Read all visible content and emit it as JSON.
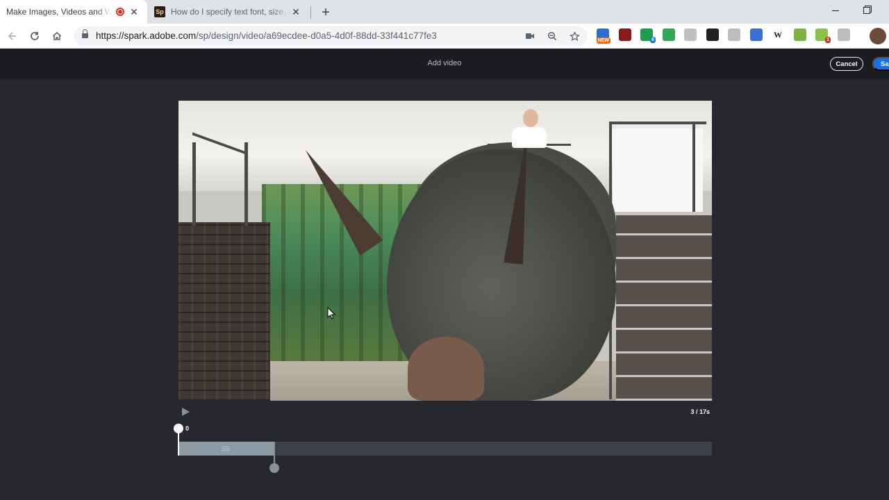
{
  "browser": {
    "tabs": [
      {
        "title": "Make Images, Videos and Web Stories",
        "active": true,
        "recording": true
      },
      {
        "title": "How do I specify text font, size, and",
        "active": false,
        "favicon": "Sp"
      }
    ],
    "new_tab_icon": "plus-icon",
    "address": {
      "host": "https://spark.adobe.com",
      "path": "/sp/design/video/a69ecdee-d0a5-4d0f-88dd-33f441c77fe3"
    },
    "extensions": [
      {
        "name": "new-badge-extension-icon",
        "badge": "NEW",
        "color": "#2a6fd6"
      },
      {
        "name": "speaker-extension-icon",
        "badge": "",
        "color": "#8b1a1a"
      },
      {
        "name": "green-chat-extension-icon",
        "badge": "6",
        "color": "#1e9e4a"
      },
      {
        "name": "green-doc-extension-icon",
        "badge": "",
        "color": "#34a853"
      },
      {
        "name": "help-circle-extension-icon",
        "badge": "",
        "color": "#c0c0c0"
      },
      {
        "name": "microphone-extension-icon",
        "badge": "",
        "color": "#202124"
      },
      {
        "name": "save-extension-icon",
        "badge": "",
        "color": "#bdbdbd"
      },
      {
        "name": "calendar-extension-icon",
        "badge": "",
        "color": "#3b6fd6"
      },
      {
        "name": "wikipedia-extension-icon",
        "badge": "W",
        "color": "#ffffff"
      },
      {
        "name": "leaf-extension-icon",
        "badge": "",
        "color": "#7cb342"
      },
      {
        "name": "android-extension-icon",
        "badge": "1",
        "color": "#8bc34a"
      },
      {
        "name": "cloud-extension-icon",
        "badge": "",
        "color": "#bdbdbd"
      }
    ]
  },
  "app": {
    "header_title": "Add video",
    "cancel_label": "Cancel",
    "save_label": "Save"
  },
  "player": {
    "playhead_label": "0",
    "time_readout": "3 / 17s",
    "selection_fraction": 0.18,
    "playhead_fraction": 0.0
  },
  "colors": {
    "accent": "#1473e6",
    "app_bg": "#26282d",
    "header_bg": "#1a1c21"
  }
}
